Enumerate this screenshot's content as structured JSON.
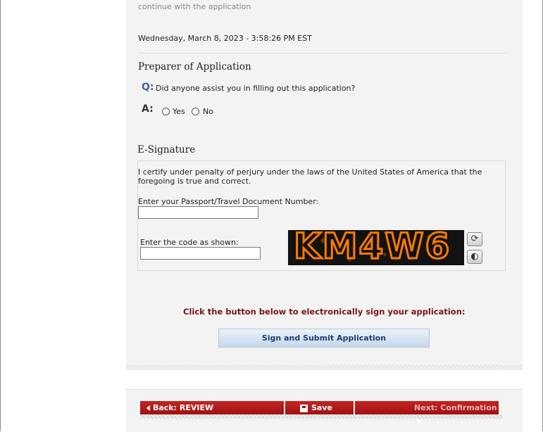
{
  "header": {
    "continue_text": "continue with the application",
    "timestamp": "Wednesday, March 8, 2023 - 3:58:26 PM EST"
  },
  "preparer": {
    "title": "Preparer of Application",
    "q_label": "Q:",
    "question": "Did anyone assist you in filling out this application?",
    "a_label": "A:",
    "option_yes": "Yes",
    "option_no": "No"
  },
  "esignature": {
    "title": "E-Signature",
    "certify_text": "I certify under penalty of perjury under the laws of the United States of America that the foregoing is true and correct.",
    "passport_label": "Enter your Passport/Travel Document Number:",
    "passport_value": "",
    "code_label": "Enter the code as shown:",
    "code_value": "",
    "captcha_text": "KM4W6",
    "refresh_icon": "refresh-icon",
    "audio_icon": "audio-icon"
  },
  "submit": {
    "prompt": "Click the button below to electronically sign your application:",
    "button_label": "Sign and Submit Application"
  },
  "nav": {
    "back_label": "Back: REVIEW",
    "save_label": "Save",
    "next_label": "Next: Confirmation"
  },
  "colors": {
    "accent_red": "#b31b1b",
    "prompt_red": "#7a1515",
    "captcha_orange": "#ff7a00",
    "question_blue": "#4a5ea8"
  }
}
